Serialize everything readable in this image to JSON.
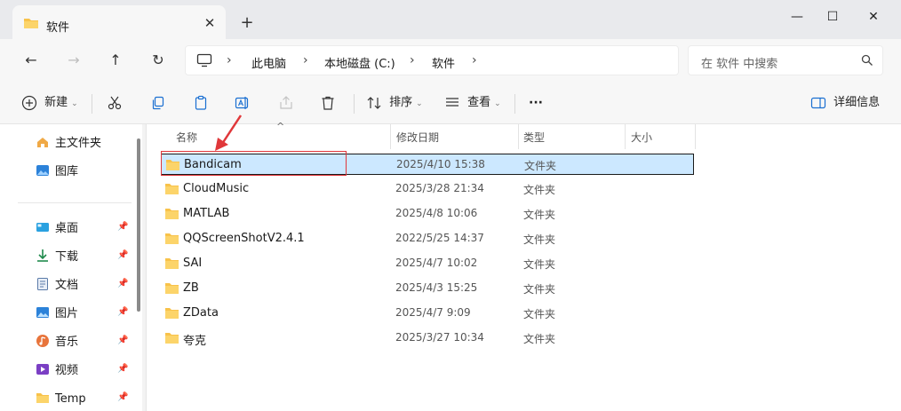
{
  "window": {
    "tab_title": "软件",
    "close_glyph": "✕",
    "newtab_glyph": "+",
    "minimize_glyph": "—",
    "maximize_glyph": "☐",
    "close_window_glyph": "✕"
  },
  "nav": {
    "back_glyph": "←",
    "forward_glyph": "→",
    "up_glyph": "↑",
    "refresh_glyph": "↻"
  },
  "breadcrumb": {
    "sep": "›",
    "items": [
      "此电脑",
      "本地磁盘 (C:)",
      "软件"
    ]
  },
  "search": {
    "placeholder": "在 软件 中搜索"
  },
  "toolbar": {
    "new_label": "新建",
    "sort_label": "排序",
    "view_label": "查看",
    "more_label": "···",
    "details_label": "详细信息",
    "dropdown_glyph": "⌄"
  },
  "sidebar": {
    "pin_glyph": "📌",
    "top_items": [
      {
        "label": "主文件夹",
        "icon": "home-icon"
      },
      {
        "label": "图库",
        "icon": "gallery-icon"
      }
    ],
    "quick_items": [
      {
        "label": "桌面",
        "icon": "desktop-icon"
      },
      {
        "label": "下载",
        "icon": "download-icon"
      },
      {
        "label": "文档",
        "icon": "document-icon"
      },
      {
        "label": "图片",
        "icon": "pictures-icon"
      },
      {
        "label": "音乐",
        "icon": "music-icon"
      },
      {
        "label": "视频",
        "icon": "video-icon"
      },
      {
        "label": "Temp",
        "icon": "folder-icon"
      }
    ]
  },
  "columns": {
    "name": "名称",
    "modified": "修改日期",
    "type": "类型",
    "size": "大小",
    "sort_caret": "^"
  },
  "files": [
    {
      "name": "Bandicam",
      "date": "2025/4/10 15:38",
      "type": "文件夹",
      "selected": true
    },
    {
      "name": "CloudMusic",
      "date": "2025/3/28 21:34",
      "type": "文件夹"
    },
    {
      "name": "MATLAB",
      "date": "2025/4/8 10:06",
      "type": "文件夹"
    },
    {
      "name": "QQScreenShotV2.4.1",
      "date": "2022/5/25 14:37",
      "type": "文件夹"
    },
    {
      "name": "SAI",
      "date": "2025/4/7 10:02",
      "type": "文件夹"
    },
    {
      "name": "ZB",
      "date": "2025/4/3 15:25",
      "type": "文件夹"
    },
    {
      "name": "ZData",
      "date": "2025/4/7 9:09",
      "type": "文件夹"
    },
    {
      "name": "夸克",
      "date": "2025/3/27 10:34",
      "type": "文件夹"
    }
  ],
  "colors": {
    "folder": "#f8c24a",
    "selection": "#cce8ff",
    "annotation": "#e0373a"
  }
}
